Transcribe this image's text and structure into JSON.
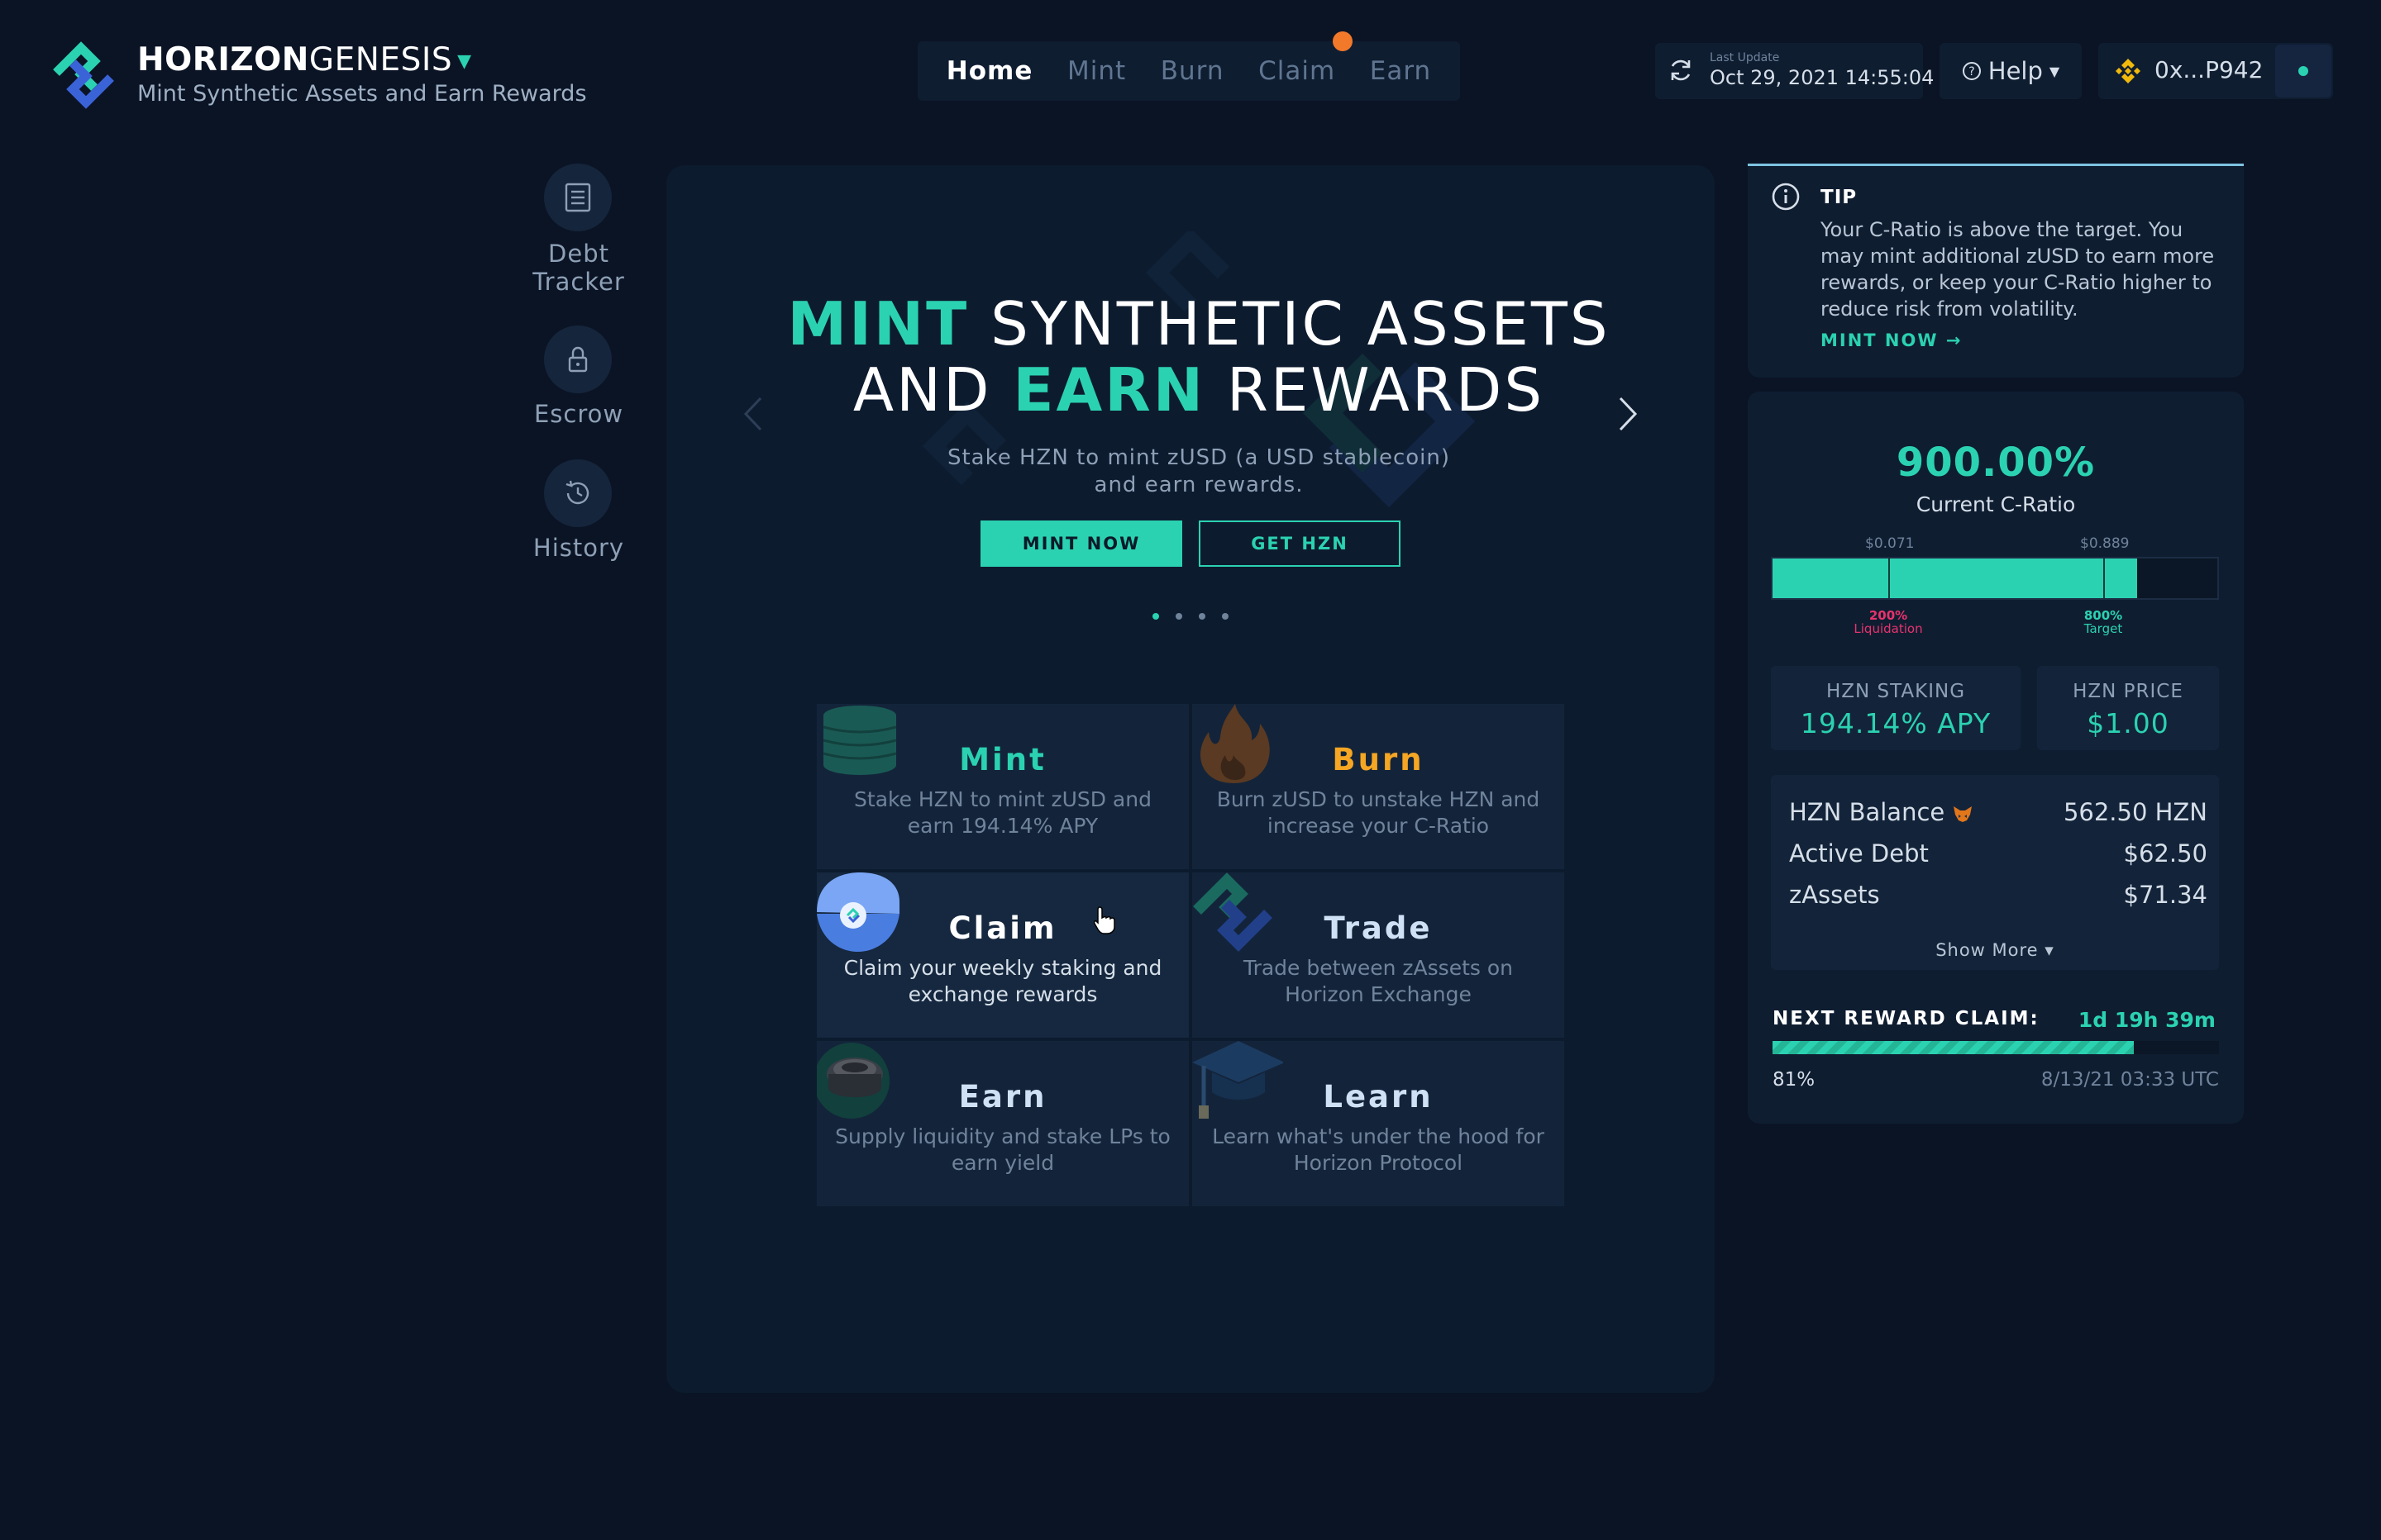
{
  "brand": {
    "name_bold": "HORIZON",
    "name_light": "GENESIS",
    "tagline": "Mint Synthetic Assets and Earn Rewards"
  },
  "topnav": {
    "items": [
      {
        "label": "Home"
      },
      {
        "label": "Mint"
      },
      {
        "label": "Burn"
      },
      {
        "label": "Claim"
      },
      {
        "label": "Earn"
      }
    ]
  },
  "update": {
    "label": "Last Update",
    "time": "Oct 29, 2021 14:55:04"
  },
  "help": {
    "label": "Help"
  },
  "wallet": {
    "address": "0x...P942"
  },
  "sidebar": {
    "items": [
      {
        "label_line1": "Debt",
        "label_line2": "Tracker"
      },
      {
        "label": "Escrow"
      },
      {
        "label": "History"
      }
    ]
  },
  "hero": {
    "title_hl_1": "MINT",
    "title_rest_1": " SYNTHETIC ASSETS",
    "title_pre_2": "AND ",
    "title_hl_2": "EARN",
    "title_rest_2": " REWARDS",
    "subtitle": "Stake HZN to mint zUSD (a USD stablecoin) and earn rewards.",
    "primary_btn": "MINT NOW",
    "secondary_btn": "GET HZN"
  },
  "cards": [
    {
      "title": "Mint",
      "desc": "Stake HZN to mint zUSD and earn 194.14% APY",
      "color": "#2bd2b1"
    },
    {
      "title": "Burn",
      "desc": "Burn zUSD to unstake HZN and increase your C-Ratio",
      "color": "#f5a623"
    },
    {
      "title": "Claim",
      "desc": "Claim your weekly staking and exchange rewards",
      "color": "#cfe1f4"
    },
    {
      "title": "Trade",
      "desc": "Trade between zAssets on Horizon Exchange",
      "color": "#cfe1f4"
    },
    {
      "title": "Earn",
      "desc": "Supply liquidity and stake LPs to earn yield",
      "color": "#cfe1f4"
    },
    {
      "title": "Learn",
      "desc": "Learn what's under the hood for Horizon Protocol",
      "color": "#cfe1f4"
    }
  ],
  "tip": {
    "title": "TIP",
    "text": "Your C-Ratio is above the target. You may mint additional zUSD to earn more rewards, or keep your C-Ratio higher to reduce risk from volatility.",
    "link": "MINT NOW →"
  },
  "cratio": {
    "value": "900.00%",
    "label": "Current C-Ratio",
    "fill_fraction": 0.82,
    "liquidation": {
      "price": "$0.071",
      "pct": "200%",
      "label": "Liquidation"
    },
    "target": {
      "price": "$0.889",
      "pct": "800%",
      "label": "Target"
    }
  },
  "staking": {
    "label": "HZN STAKING",
    "value": "194.14% APY"
  },
  "price": {
    "label": "HZN PRICE",
    "value": "$1.00"
  },
  "balances": {
    "rows": [
      {
        "label": "HZN Balance",
        "value": "562.50 HZN"
      },
      {
        "label": "Active Debt",
        "value": "$62.50"
      },
      {
        "label": "zAssets",
        "value": "$71.34"
      }
    ],
    "show_more": "Show More ▾"
  },
  "reward": {
    "label": "NEXT REWARD CLAIM:",
    "time": "1d 19h 39m",
    "progress_pct": 81,
    "pct_text": "81%",
    "date": "8/13/21 03:33 UTC"
  },
  "colors": {
    "accent": "#2bd2b1",
    "burn": "#f5a623",
    "liquidation": "#e8336d",
    "notification": "#f2782a"
  }
}
